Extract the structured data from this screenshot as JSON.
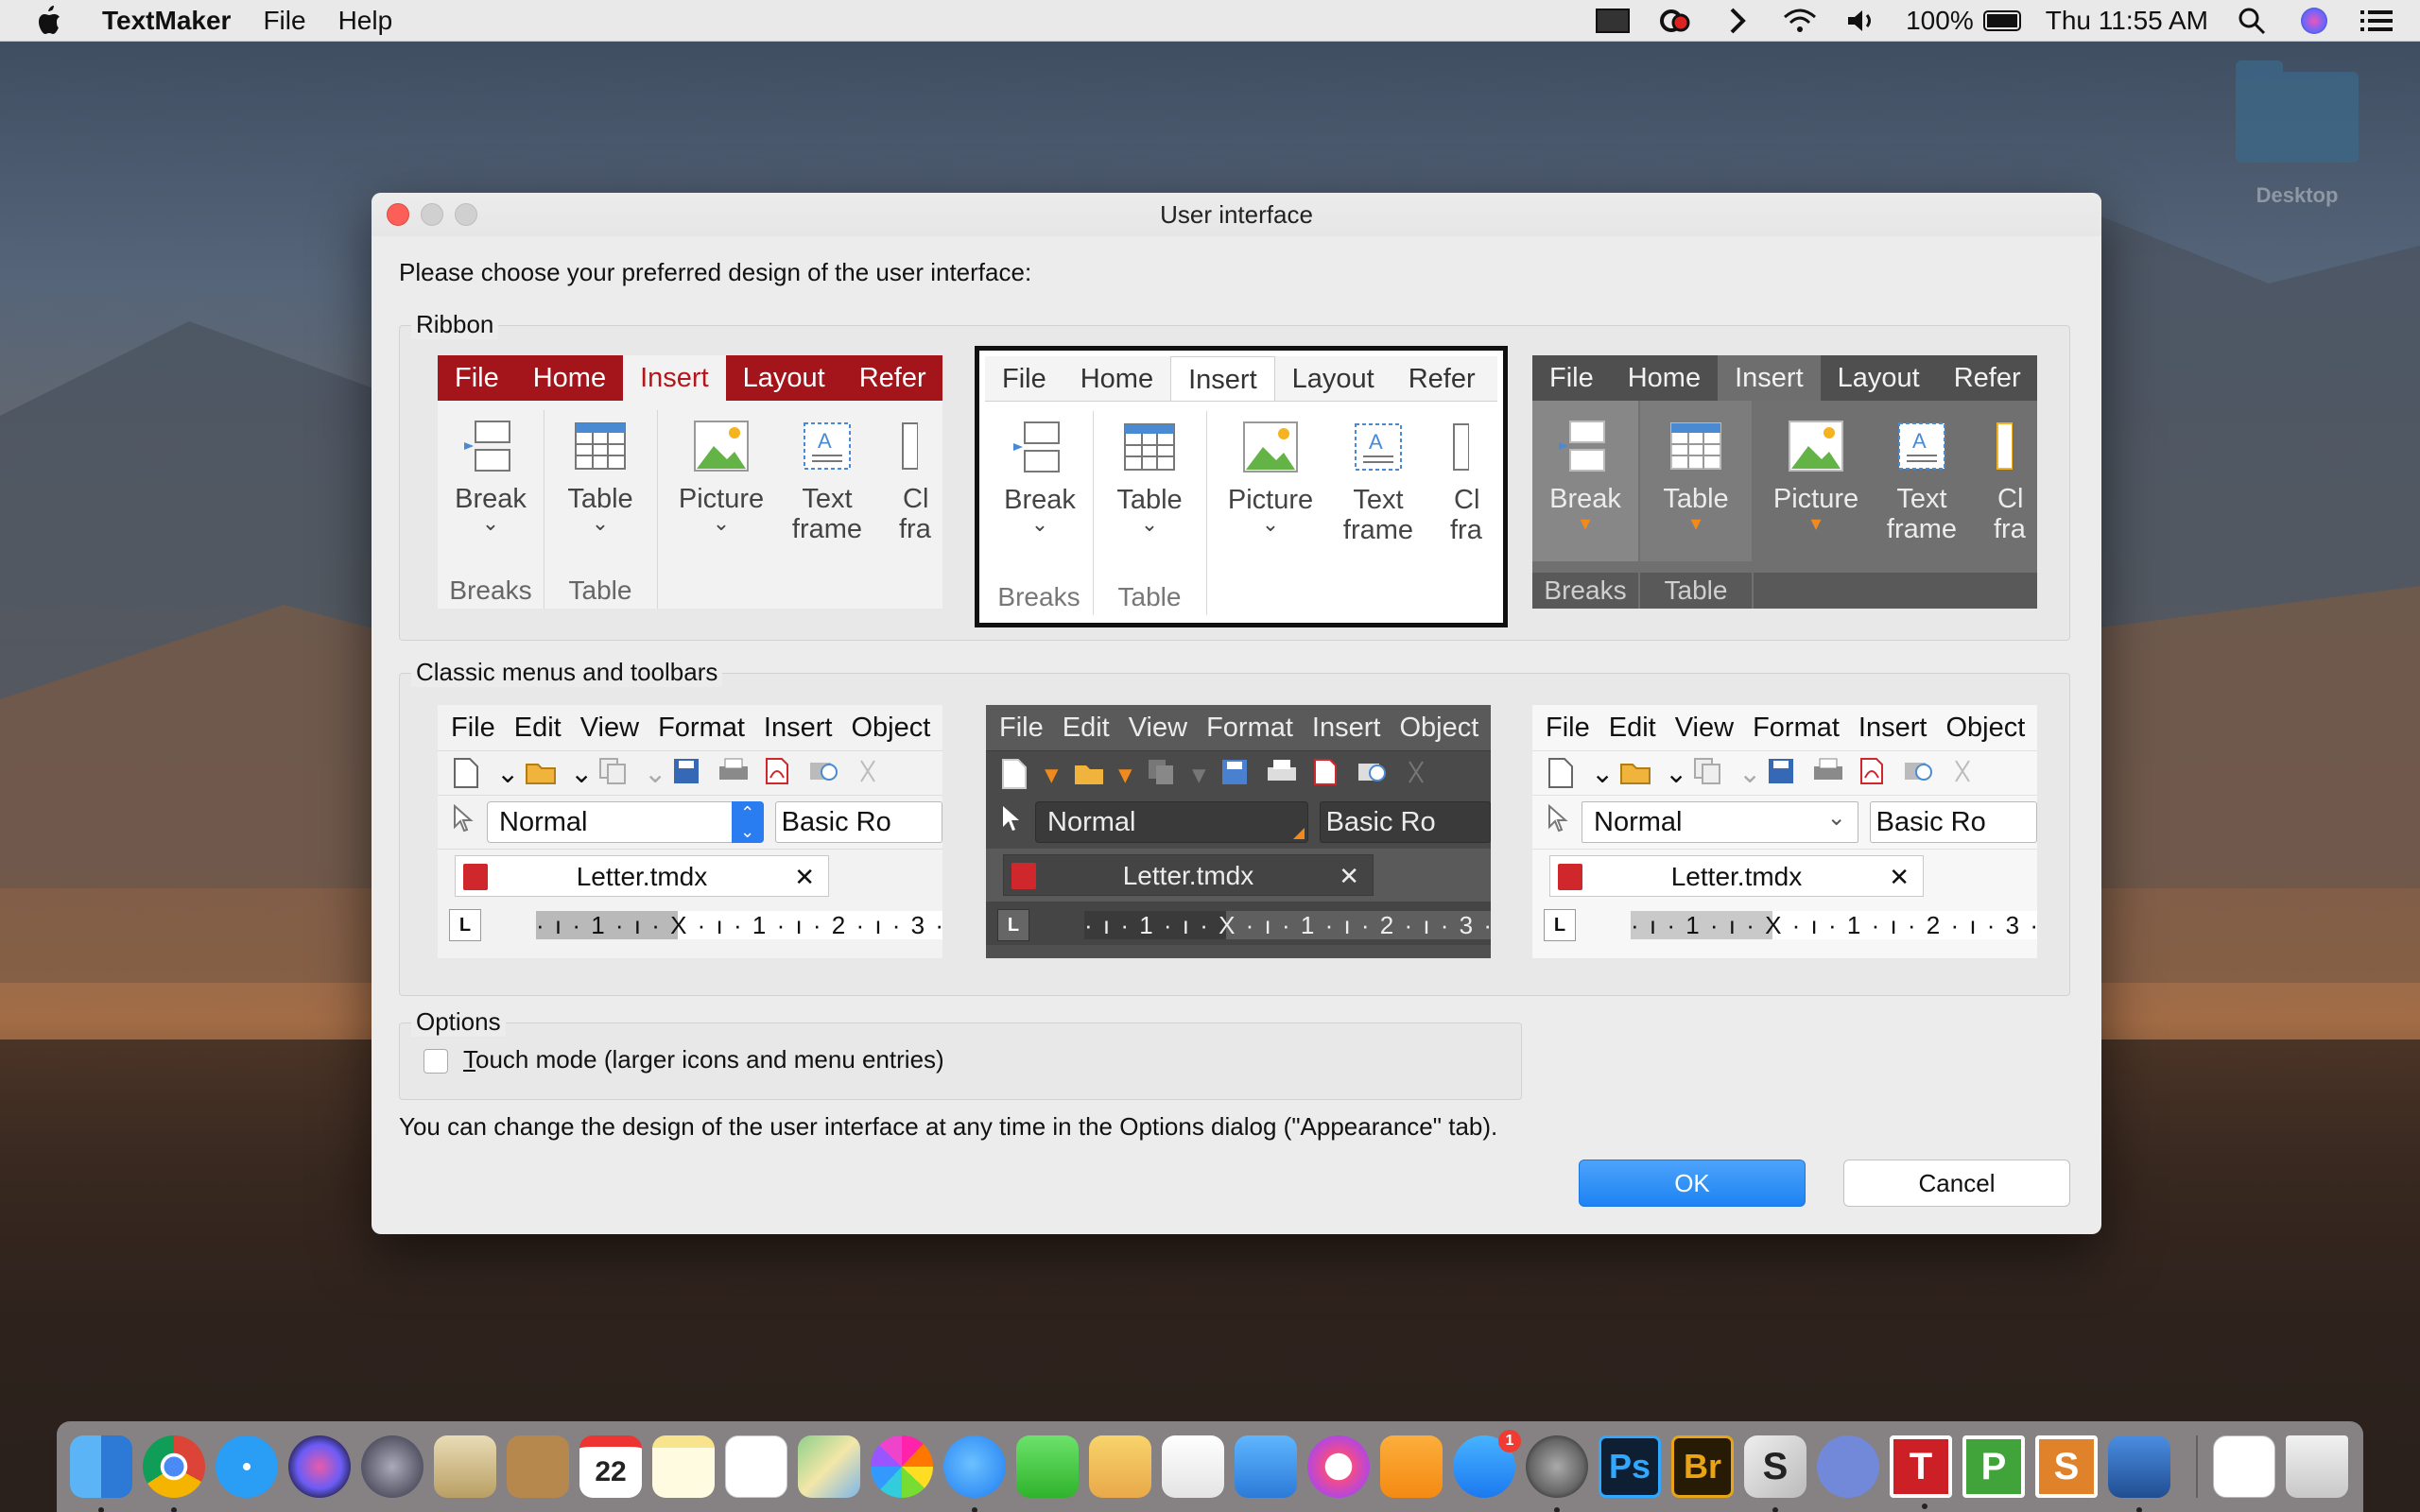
{
  "menubar": {
    "app": "TextMaker",
    "items": [
      "File",
      "Help"
    ],
    "battery": "100%",
    "clock": "Thu 11:55 AM"
  },
  "desktop": {
    "label": "Desktop"
  },
  "dialog": {
    "title": "User interface",
    "prompt": "Please choose your preferred design of the user interface:",
    "ribbon_label": "Ribbon",
    "classic_label": "Classic menus and toolbars",
    "options_label": "Options",
    "touch_label": "Touch mode (larger icons and menu entries)",
    "touch_underline": "T",
    "touch_rest": "ouch mode (larger icons and menu entries)",
    "footer": "You can change the design of the user interface at any time in the Options dialog (\"Appearance\" tab).",
    "ok": "OK",
    "cancel": "Cancel"
  },
  "ribbon": {
    "tabs": [
      "File",
      "Home",
      "Insert",
      "Layout",
      "Refer"
    ],
    "buttons": {
      "break": "Break",
      "table": "Table",
      "picture": "Picture",
      "textframe1": "Text",
      "textframe2": "frame",
      "clip1": "Cl",
      "clip2": "fra"
    },
    "groups": {
      "breaks": "Breaks",
      "table": "Table"
    }
  },
  "classic": {
    "menus": [
      "File",
      "Edit",
      "View",
      "Format",
      "Insert",
      "Object"
    ],
    "style": "Normal",
    "font": "Basic Ro",
    "doc": "Letter.tmdx",
    "ruler": "· ı · 1 · ı · X · ı · 1 · ı · 2 · ı · 3 · ı"
  },
  "colors": {
    "accent": "#1d83f3",
    "ribbon_red": "#a3151b",
    "ribbon_dark": "#5a5a5a",
    "classic_dark": "#4a4a4a"
  }
}
